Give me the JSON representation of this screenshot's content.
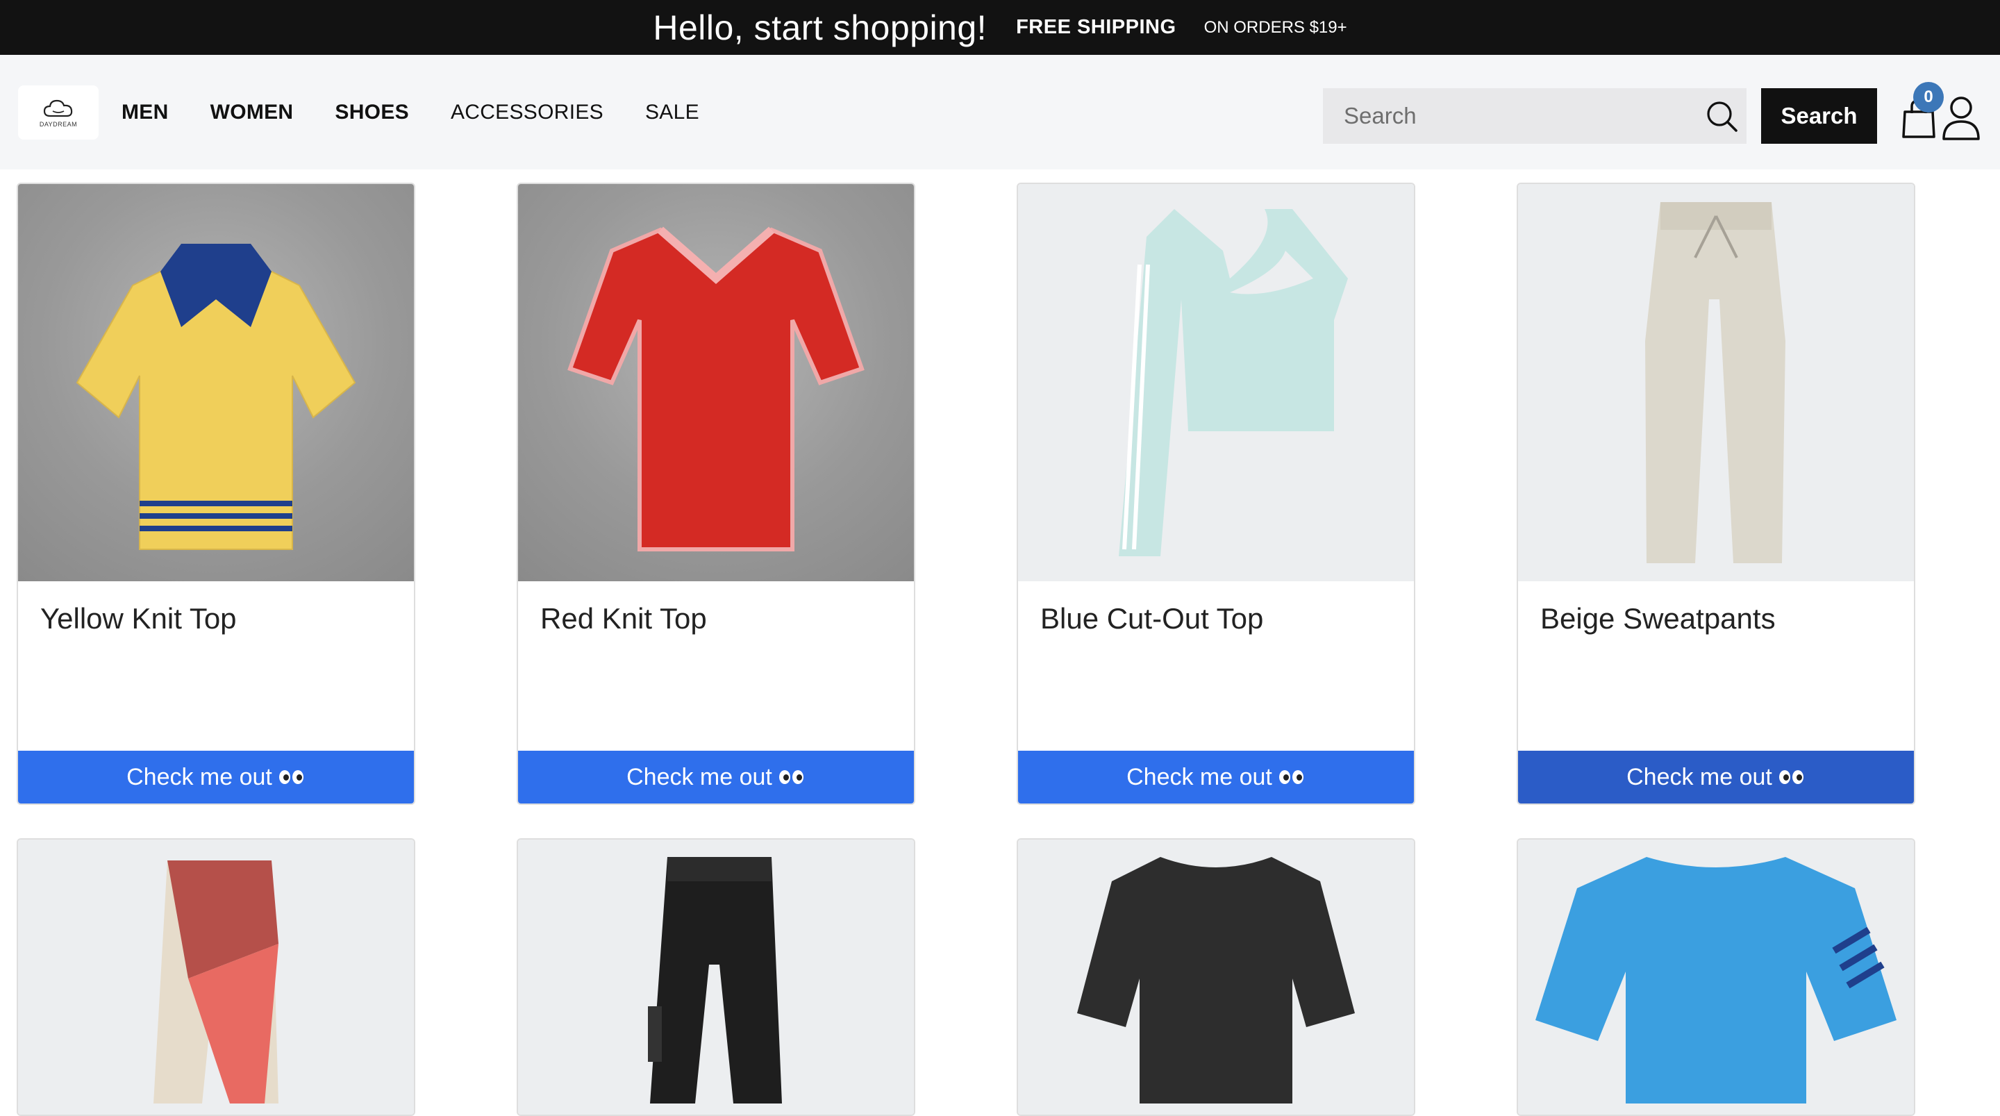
{
  "banner": {
    "greeting": "Hello, start shopping!",
    "free_shipping": "FREE SHIPPING",
    "orders": "ON ORDERS $19+"
  },
  "header": {
    "logo_text": "DAYDREAM",
    "nav": [
      {
        "label": "MEN"
      },
      {
        "label": "WOMEN"
      },
      {
        "label": "SHOES"
      },
      {
        "label": "ACCESSORIES"
      },
      {
        "label": "SALE"
      }
    ],
    "search": {
      "placeholder": "Search",
      "button_label": "Search"
    },
    "cart_count": "0"
  },
  "products": [
    {
      "title": "Yellow Knit Top",
      "cta": "Check me out"
    },
    {
      "title": "Red Knit Top",
      "cta": "Check me out"
    },
    {
      "title": "Blue Cut-Out Top",
      "cta": "Check me out"
    },
    {
      "title": "Beige Sweatpants",
      "cta": "Check me out"
    },
    {
      "title": "",
      "cta": ""
    },
    {
      "title": "",
      "cta": ""
    },
    {
      "title": "",
      "cta": ""
    },
    {
      "title": "",
      "cta": ""
    }
  ],
  "colors": {
    "banner_bg": "#121212",
    "header_bg": "#f5f6f8",
    "cta_blue": "#2f6fec",
    "cta_blue_hover": "#2b5cc7",
    "badge_blue": "#3c77b8"
  }
}
